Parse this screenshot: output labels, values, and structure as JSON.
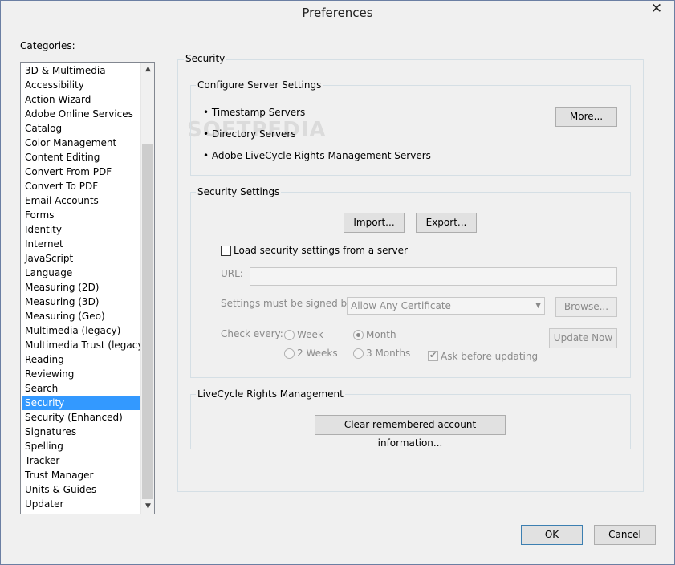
{
  "window": {
    "title": "Preferences",
    "close_glyph": "✕"
  },
  "categories": {
    "label": "Categories:",
    "items": [
      "3D & Multimedia",
      "Accessibility",
      "Action Wizard",
      "Adobe Online Services",
      "Catalog",
      "Color Management",
      "Content Editing",
      "Convert From PDF",
      "Convert To PDF",
      "Email Accounts",
      "Forms",
      "Identity",
      "Internet",
      "JavaScript",
      "Language",
      "Measuring (2D)",
      "Measuring (3D)",
      "Measuring (Geo)",
      "Multimedia (legacy)",
      "Multimedia Trust (legacy)",
      "Reading",
      "Reviewing",
      "Search",
      "Security",
      "Security (Enhanced)",
      "Signatures",
      "Spelling",
      "Tracker",
      "Trust Manager",
      "Units & Guides",
      "Updater"
    ],
    "selected": "Security"
  },
  "security": {
    "title": "Security",
    "server": {
      "title": "Configure Server Settings",
      "bullets": [
        "• Timestamp Servers",
        "• Directory Servers",
        "• Adobe LiveCycle Rights Management Servers"
      ],
      "more_label": "More..."
    },
    "settings": {
      "title": "Security Settings",
      "import_label": "Import...",
      "export_label": "Export...",
      "load_label": "Load security settings from a server",
      "load_checked": false,
      "url_label": "URL:",
      "url_value": "",
      "signed_label": "Settings must be signed by:",
      "signed_value": "Allow Any Certificate",
      "browse_label": "Browse...",
      "check_label": "Check every:",
      "week_label": "Week",
      "month_label": "Month",
      "two_weeks_label": "2 Weeks",
      "three_months_label": "3 Months",
      "check_selected": "Month",
      "ask_label": "Ask before updating",
      "ask_checked": true,
      "update_label": "Update Now"
    },
    "livecycle": {
      "title": "LiveCycle Rights Management",
      "clear_label": "Clear remembered account information..."
    }
  },
  "footer": {
    "ok_label": "OK",
    "cancel_label": "Cancel"
  },
  "watermark": "SOFTPEDIA"
}
